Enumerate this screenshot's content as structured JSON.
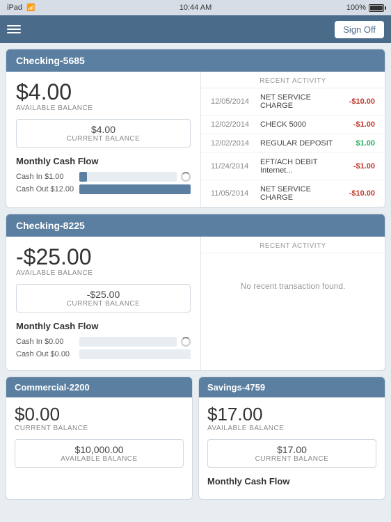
{
  "statusBar": {
    "carrier": "iPad",
    "time": "10:44 AM",
    "battery": "100%"
  },
  "toolbar": {
    "signOffLabel": "Sign Off"
  },
  "accounts": [
    {
      "id": "checking-5685",
      "title": "Checking-5685",
      "availableBalance": "$4.00",
      "availableBalanceLabel": "AVAILABLE BALANCE",
      "currentBalance": "$4.00",
      "currentBalanceLabel": "CURRENT BALANCE",
      "cashFlow": {
        "title": "Monthly Cash Flow",
        "cashIn": {
          "label": "Cash In $1.00",
          "value": 1,
          "max": 12
        },
        "cashOut": {
          "label": "Cash Out $12.00",
          "value": 12,
          "max": 12
        }
      },
      "recentActivityLabel": "RECENT ACTIVITY",
      "transactions": [
        {
          "date": "12/05/2014",
          "desc": "NET SERVICE CHARGE",
          "amount": "-$10.00",
          "type": "negative"
        },
        {
          "date": "12/02/2014",
          "desc": "CHECK 5000",
          "amount": "-$1.00",
          "type": "negative"
        },
        {
          "date": "12/02/2014",
          "desc": "REGULAR DEPOSIT",
          "amount": "$1.00",
          "type": "positive"
        },
        {
          "date": "11/24/2014",
          "desc": "EFT/ACH DEBIT Internet...",
          "amount": "-$1.00",
          "type": "negative"
        },
        {
          "date": "11/05/2014",
          "desc": "NET SERVICE CHARGE",
          "amount": "-$10.00",
          "type": "negative"
        }
      ]
    },
    {
      "id": "checking-8225",
      "title": "Checking-8225",
      "availableBalance": "-$25.00",
      "availableBalanceLabel": "AVAILABLE BALANCE",
      "currentBalance": "-$25.00",
      "currentBalanceLabel": "CURRENT BALANCE",
      "cashFlow": {
        "title": "Monthly Cash Flow",
        "cashIn": {
          "label": "Cash In $0.00",
          "value": 0,
          "max": 12
        },
        "cashOut": {
          "label": "Cash Out $0.00",
          "value": 0,
          "max": 12
        }
      },
      "recentActivityLabel": "RECENT ACTIVITY",
      "noTransactions": "No recent transaction found.",
      "transactions": []
    }
  ],
  "bottomCards": [
    {
      "id": "commercial-2200",
      "title": "Commercial-2200",
      "primaryAmount": "$0.00",
      "primaryLabel": "CURRENT BALANCE",
      "secondaryValue": "$10,000.00",
      "secondaryLabel": "AVAILABLE BALANCE",
      "secondaryBoxLabel": "AVAILABLE BALANCE"
    },
    {
      "id": "savings-4759",
      "title": "Savings-4759",
      "primaryAmount": "$17.00",
      "primaryLabel": "AVAILABLE BALANCE",
      "secondaryValue": "$17.00",
      "secondaryLabel": "CURRENT BALANCE",
      "secondaryBoxLabel": "CURRENT BALANCE",
      "hasCashFlow": true,
      "cashFlowTitle": "Monthly Cash Flow"
    }
  ]
}
